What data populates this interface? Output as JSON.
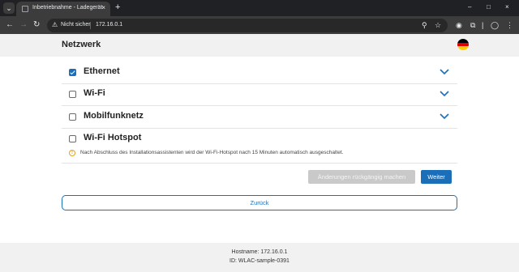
{
  "browser": {
    "tab_title": "Inbetriebnahme - Ladegerät",
    "tab_close": "×",
    "new_tab": "+",
    "security_label": "Nicht sicher",
    "url": "172.16.0.1",
    "window_controls": [
      "–",
      "□",
      "×"
    ]
  },
  "header": {
    "title": "Netzwerk",
    "language_flag": "german-flag-icon",
    "flag_colors": [
      "#000000",
      "#dd0000",
      "#ffce00"
    ]
  },
  "network": {
    "items": [
      {
        "label": "Ethernet",
        "checked": true,
        "expandable": true
      },
      {
        "label": "Wi-Fi",
        "checked": false,
        "expandable": true
      },
      {
        "label": "Mobilfunknetz",
        "checked": false,
        "expandable": true
      },
      {
        "label": "Wi-Fi Hotspot",
        "checked": false,
        "expandable": false
      }
    ],
    "hotspot_info": "Nach Abschluss des Installationsassistenten wird der Wi-Fi-Hotspot nach 15 Minuten automatisch ausgeschaltet."
  },
  "actions": {
    "revert_label": "Änderungen rückgängig machen",
    "next_label": "Weiter",
    "back_label": "Zurück"
  },
  "footer": {
    "hostname": "Hostname: 172.16.0.1",
    "id": "ID: WLAC-sample-0391"
  },
  "colors": {
    "accent": "#1a6fb8",
    "disabled_button": "#c9c9c9",
    "warning": "#e3a21a"
  }
}
